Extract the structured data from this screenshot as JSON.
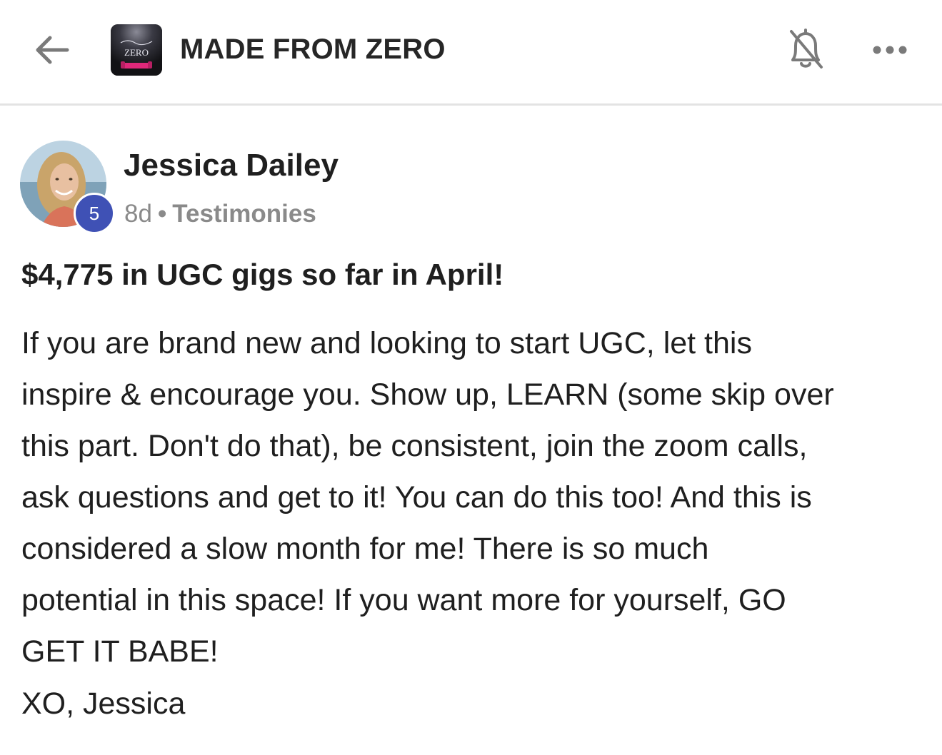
{
  "header": {
    "back_icon": "arrow-left-icon",
    "group_name": "MADE FROM ZERO",
    "logo_text": "ZERO",
    "notification_icon": "bell-off-icon",
    "more_icon": "more-horizontal-icon"
  },
  "post": {
    "author": {
      "name": "Jessica Dailey",
      "level": "5"
    },
    "age": "8d",
    "separator": "•",
    "category": "Testimonies",
    "title": "$4,775 in UGC gigs so far in April!",
    "body_lines": [
      "If you are brand new and looking to start UGC, let this",
      "inspire & encourage you. Show up, LEARN (some skip over",
      "this part. Don't do that), be consistent, join the zoom calls,",
      "ask questions and get to it! You can do this too! And this is",
      "considered a slow month for me! There is so much",
      "potential in this space! If you want more for yourself, GO",
      "GET IT BABE!"
    ],
    "sign_off": "XO, Jessica"
  },
  "colors": {
    "badge": "#3f51b5",
    "divider": "#e3e3e3",
    "muted_text": "#8a8a8a",
    "text": "#1f1f1f"
  }
}
